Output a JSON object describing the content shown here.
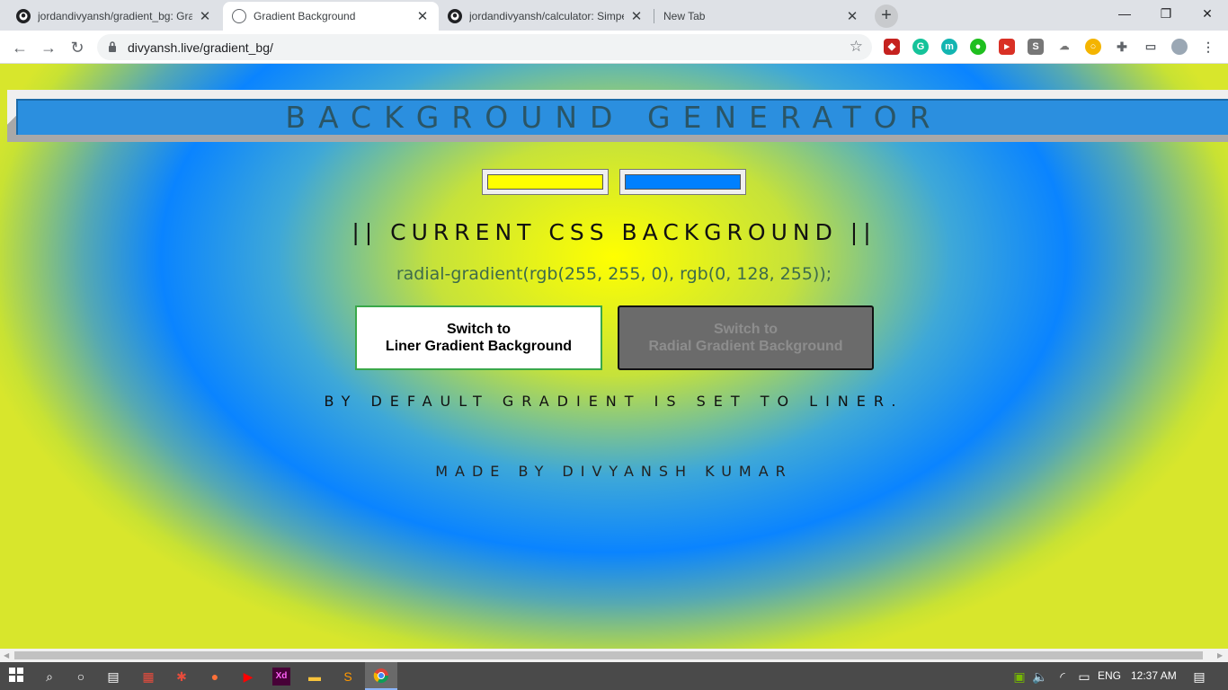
{
  "browser": {
    "tabs": [
      {
        "title": "jordandivyansh/gradient_bg: Gra",
        "icon": "github-icon",
        "active": false
      },
      {
        "title": "Gradient Background",
        "icon": "globe-icon",
        "active": true
      },
      {
        "title": "jordandivyansh/calculator: Simpe",
        "icon": "github-icon",
        "active": false
      },
      {
        "title": "New Tab",
        "icon": "none",
        "active": false
      }
    ],
    "new_tab_label": "+",
    "url": "divyansh.live/gradient_bg/",
    "window_controls": {
      "minimize": "—",
      "maximize": "❐",
      "close": "✕"
    },
    "nav": {
      "back": "←",
      "forward": "→",
      "reload": "↻"
    }
  },
  "page": {
    "title": "BACKGROUND GENERATOR",
    "colors": {
      "color1": "#ffff00",
      "color2": "#0080ff"
    },
    "current_label": "|| CURRENT CSS BACKGROUND ||",
    "css_value": "radial-gradient(rgb(255, 255, 0), rgb(0, 128, 255));",
    "buttons": {
      "liner": {
        "line1": "Switch to",
        "line2": "Liner Gradient Background"
      },
      "radial": {
        "line1": "Switch to",
        "line2": "Radial Gradient Background"
      }
    },
    "note": "BY DEFAULT GRADIENT IS SET TO LINER.",
    "credit": "MADE BY DIVYANSH KUMAR"
  },
  "taskbar": {
    "language": "ENG",
    "time": "12:37 AM"
  }
}
